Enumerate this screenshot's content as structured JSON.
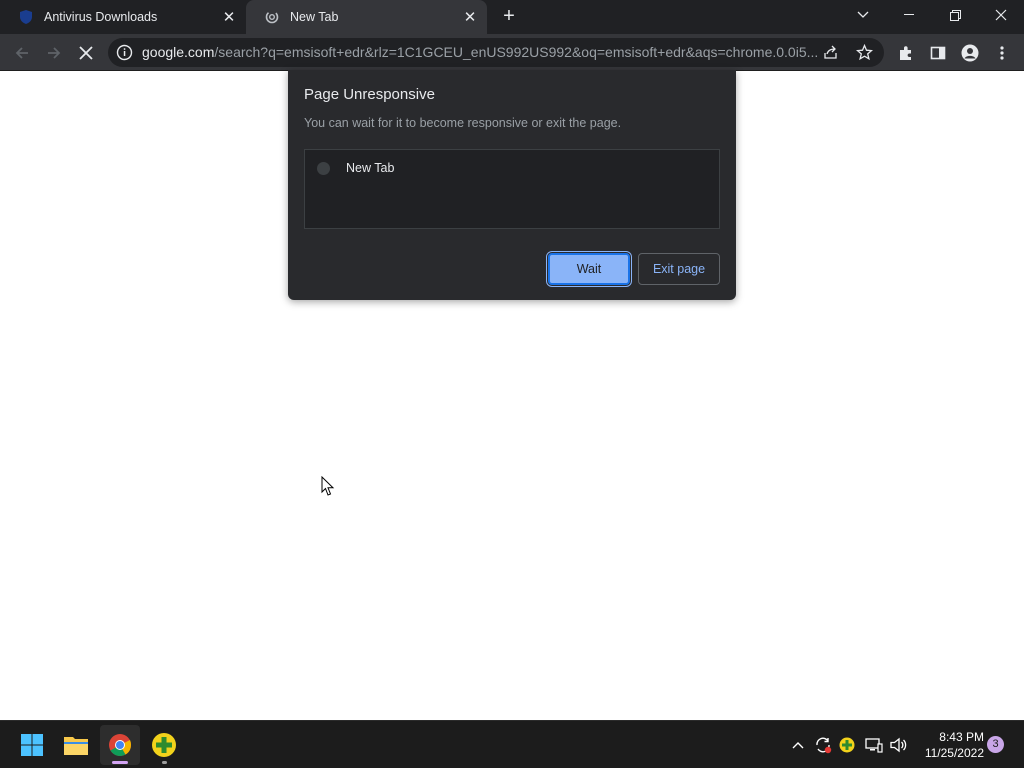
{
  "browser": {
    "tabs": [
      {
        "title": "Antivirus Downloads",
        "favicon": "shield-icon",
        "active": false
      },
      {
        "title": "New Tab",
        "favicon": "loading-spinner-icon",
        "active": true
      }
    ],
    "new_tab_label": "+",
    "address_host": "google.com",
    "address_path": "/search?q=emsisoft+edr&rlz=1C1GCEU_enUS992US992&oq=emsisoft+edr&aqs=chrome.0.0i5..."
  },
  "dialog": {
    "title": "Page Unresponsive",
    "message": "You can wait for it to become responsive or exit the page.",
    "pages": [
      "New Tab"
    ],
    "wait_label": "Wait",
    "exit_label": "Exit page"
  },
  "taskbar": {
    "apps": [
      "windows-start-icon",
      "file-explorer-icon",
      "chrome-icon",
      "emsisoft-icon"
    ],
    "time": "8:43 PM",
    "date": "11/25/2022",
    "notification_count": "3"
  },
  "colors": {
    "accent": "#8ab4f8",
    "chrome_dark": "#202124",
    "toolbar": "#35363a",
    "dialog_bg": "#292a2d"
  }
}
